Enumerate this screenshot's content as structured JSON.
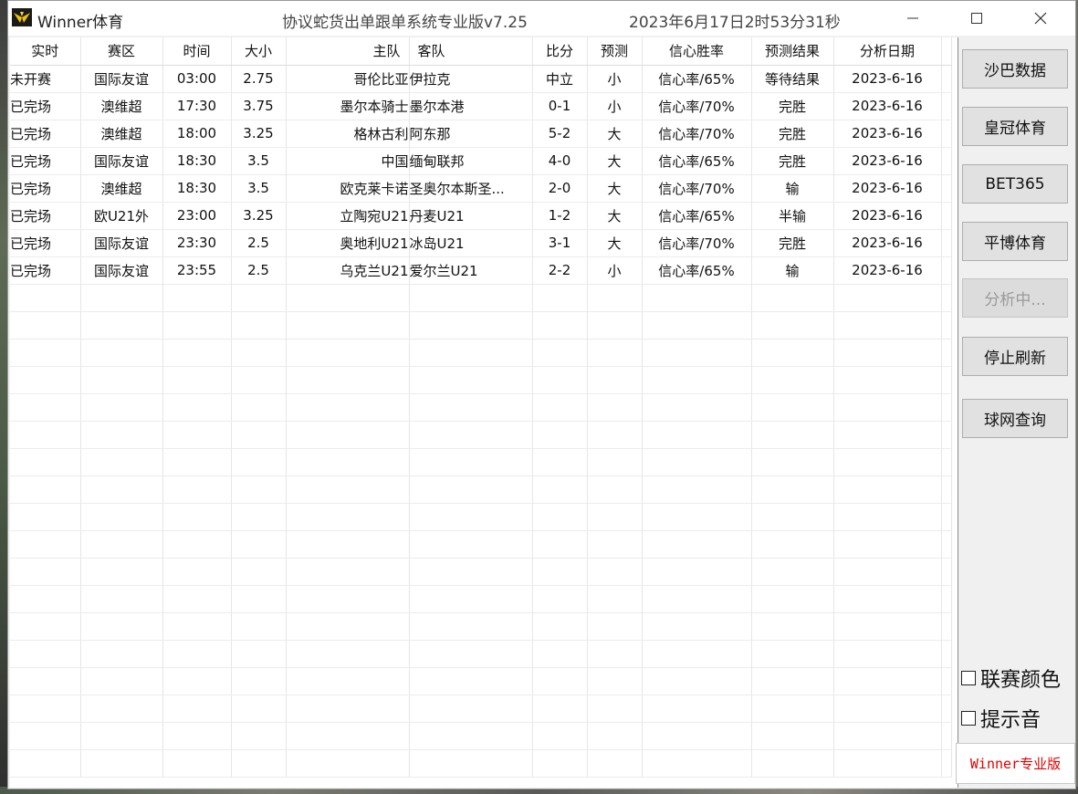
{
  "window": {
    "app_title": "Winner体育",
    "system_title": "协议蛇货出单跟单系统专业版v7.25",
    "clock": "2023年6月17日2时53分31秒"
  },
  "table": {
    "columns": [
      "实时",
      "赛区",
      "时间",
      "大小",
      "主队",
      "客队",
      "比分",
      "预测",
      "信心胜率",
      "预测结果",
      "分析日期"
    ],
    "rows": [
      [
        "未开赛",
        "国际友谊",
        "03:00",
        "2.75",
        "哥伦比亚",
        "伊拉克",
        "中立",
        "小",
        "信心率/65%",
        "等待结果",
        "2023-6-16"
      ],
      [
        "已完场",
        "澳维超",
        "17:30",
        "3.75",
        "墨尔本骑士",
        "墨尔本港",
        "0-1",
        "小",
        "信心率/70%",
        "完胜",
        "2023-6-16"
      ],
      [
        "已完场",
        "澳维超",
        "18:00",
        "3.25",
        "格林古利",
        "阿东那",
        "5-2",
        "大",
        "信心率/70%",
        "完胜",
        "2023-6-16"
      ],
      [
        "已完场",
        "国际友谊",
        "18:30",
        "3.5",
        "中国",
        "缅甸联邦",
        "4-0",
        "大",
        "信心率/65%",
        "完胜",
        "2023-6-16"
      ],
      [
        "已完场",
        "澳维超",
        "18:30",
        "3.5",
        "欧克莱卡诺",
        "圣奥尔本斯圣...",
        "2-0",
        "大",
        "信心率/70%",
        "输",
        "2023-6-16"
      ],
      [
        "已完场",
        "欧U21外",
        "23:00",
        "3.25",
        "立陶宛U21",
        "丹麦U21",
        "1-2",
        "大",
        "信心率/65%",
        "半输",
        "2023-6-16"
      ],
      [
        "已完场",
        "国际友谊",
        "23:30",
        "2.5",
        "奥地利U21",
        "冰岛U21",
        "3-1",
        "大",
        "信心率/70%",
        "完胜",
        "2023-6-16"
      ],
      [
        "已完场",
        "国际友谊",
        "23:55",
        "2.5",
        "乌克兰U21",
        "爱尔兰U21",
        "2-2",
        "小",
        "信心率/65%",
        "输",
        "2023-6-16"
      ]
    ],
    "empty_rows": 18
  },
  "sidebar": {
    "buttons": [
      {
        "label": "沙巴数据",
        "enabled": true
      },
      {
        "label": "皇冠体育",
        "enabled": true
      },
      {
        "label": "BET365",
        "enabled": true
      },
      {
        "label": "平博体育",
        "enabled": true
      },
      {
        "label": "分析中...",
        "enabled": false
      },
      {
        "label": "停止刷新",
        "enabled": true
      },
      {
        "label": "球网查询",
        "enabled": true
      }
    ],
    "checkboxes": [
      {
        "label": "联赛颜色",
        "checked": false
      },
      {
        "label": "提示音",
        "checked": false
      }
    ],
    "brand": "Winner专业版"
  },
  "colors": {
    "brand_text": "#e00000",
    "window_bg": "#f0f0f0",
    "button_bg": "#e1e1e1"
  }
}
